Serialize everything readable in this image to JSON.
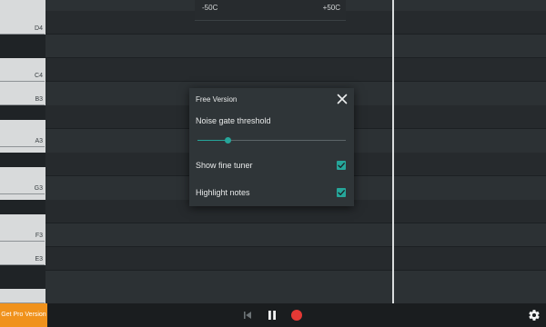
{
  "tuner": {
    "min_label": "-50C",
    "max_label": "+50C"
  },
  "keyboard": {
    "labels": [
      "D4",
      "C4",
      "B3",
      "A3",
      "G3",
      "F3",
      "E3"
    ]
  },
  "dialog": {
    "title": "Free Version",
    "noise_gate_label": "Noise gate threshold",
    "noise_gate_value": 0.2,
    "show_fine_tuner_label": "Show fine tuner",
    "show_fine_tuner_checked": true,
    "highlight_notes_label": "Highlight notes",
    "highlight_notes_checked": true,
    "close_icon": "close-icon"
  },
  "bottom_bar": {
    "pro_label": "Get Pro Version",
    "controls": [
      "skip-previous-icon",
      "pause-icon",
      "record-icon",
      "gear-icon"
    ]
  },
  "colors": {
    "accent": "#26a69a",
    "pro": "#f0921c",
    "record": "#e53935"
  }
}
